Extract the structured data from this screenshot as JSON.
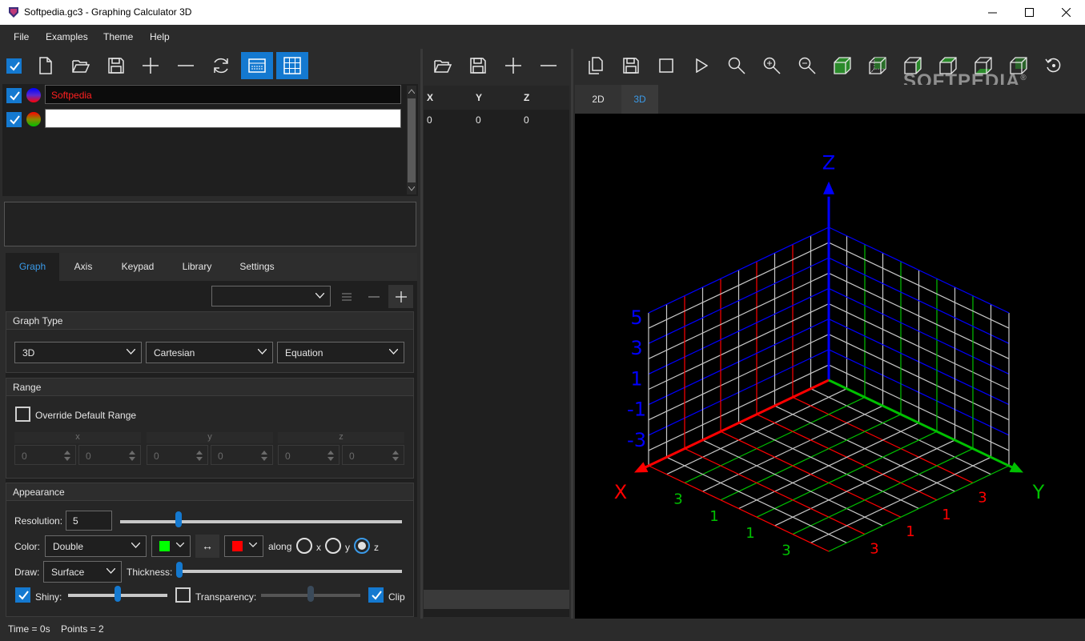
{
  "window": {
    "title": "Softpedia.gc3 - Graphing Calculator 3D",
    "minimize_icon": "minimize-icon",
    "maximize_icon": "maximize-icon",
    "close_icon": "close-icon"
  },
  "menu": {
    "items": [
      "File",
      "Examples",
      "Theme",
      "Help"
    ]
  },
  "equations": [
    {
      "text": "Softpedia",
      "checked": true,
      "color_a": "#0000ff",
      "color_b": "#ff0000"
    },
    {
      "text": "",
      "checked": true,
      "color_a": "#ff0000",
      "color_b": "#00c000"
    }
  ],
  "points_table": {
    "headers": [
      "X",
      "Y",
      "Z"
    ],
    "rows": [
      [
        "0",
        "0",
        "0"
      ]
    ]
  },
  "tabs": [
    "Graph",
    "Axis",
    "Keypad",
    "Library",
    "Settings"
  ],
  "active_tab": "Graph",
  "graph_type": {
    "title": "Graph Type",
    "dimension": "3D",
    "coordinate": "Cartesian",
    "form": "Equation"
  },
  "range": {
    "title": "Range",
    "override_label": "Override Default Range",
    "override_checked": false,
    "axes": [
      {
        "name": "x",
        "min": "0",
        "max": "0"
      },
      {
        "name": "y",
        "min": "0",
        "max": "0"
      },
      {
        "name": "z",
        "min": "0",
        "max": "0"
      }
    ]
  },
  "appearance": {
    "title": "Appearance",
    "resolution_label": "Resolution:",
    "resolution_value": "5",
    "resolution_fraction": 0.2,
    "color_label": "Color:",
    "color_mode": "Double",
    "color_1": "#00ff00",
    "color_2": "#ff0000",
    "swap_icon": "swap-arrows-icon",
    "swap_text": "↔",
    "along_label": "along",
    "along_options": [
      "x",
      "y",
      "z"
    ],
    "along_selected": "z",
    "draw_label": "Draw:",
    "draw_mode": "Surface",
    "thickness_label": "Thickness:",
    "thickness_fraction": 0.0,
    "shiny_label": "Shiny:",
    "shiny_checked": true,
    "shiny_fraction": 0.5,
    "transparency_label": "Transparency:",
    "transparency_checked": false,
    "transparency_fraction": 0.5,
    "clip_label": "Clip",
    "clip_checked": true
  },
  "view_tabs": [
    "2D",
    "3D"
  ],
  "active_view_tab": "3D",
  "status": {
    "time": "Time = 0s",
    "points": "Points = 2"
  },
  "watermark": "SOFTPEDIA",
  "watermark_mark": "®",
  "plot": {
    "axis_x_label": "X",
    "axis_y_label": "Y",
    "axis_z_label": "Z",
    "z_ticks": [
      "5",
      "3",
      "1",
      "-1",
      "-3"
    ],
    "x_floor_ticks": [
      "3",
      "1",
      "1",
      "3"
    ],
    "y_floor_ticks": [
      "3",
      "1",
      "1",
      "3"
    ],
    "colors": {
      "x": "#ff0000",
      "y": "#00c000",
      "z": "#0000ff",
      "grid": "#c8c8c8"
    }
  }
}
